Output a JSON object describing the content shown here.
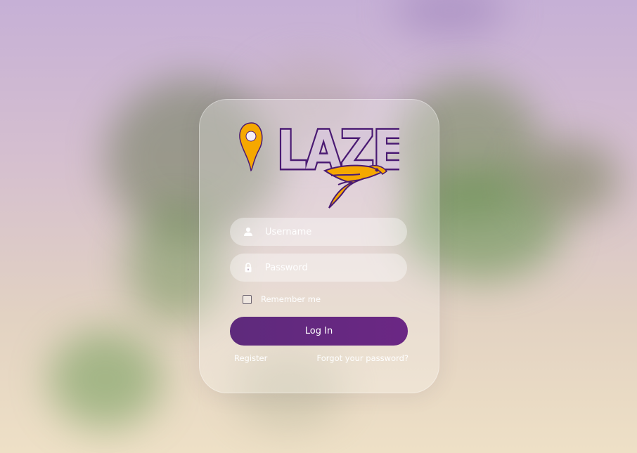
{
  "brand": {
    "name": "LAZE"
  },
  "login": {
    "username_placeholder": "Username",
    "password_placeholder": "Password",
    "remember_label": "Remember me",
    "remember_checked": false,
    "submit_label": "Log In",
    "register_label": "Register",
    "forgot_label": "Forgot your password?"
  },
  "icons": {
    "username": "user-icon",
    "password": "lock-icon",
    "logo_pin": "map-pin-icon",
    "logo_bird": "bird-icon"
  },
  "colors": {
    "brand_purple": "#5e2a7c",
    "logo_gold": "#f5a800",
    "logo_outline": "#4a1a73",
    "text_white": "#ffffff"
  }
}
